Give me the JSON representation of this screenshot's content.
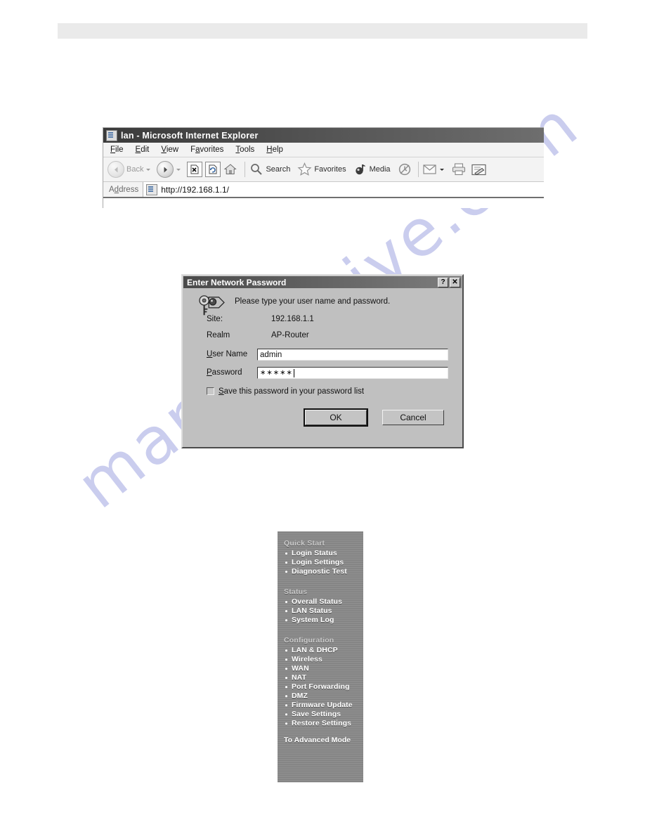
{
  "page": {
    "band_present": true,
    "watermark_text": "manualshive.com"
  },
  "browser": {
    "title": "lan - Microsoft Internet Explorer",
    "title_icon": "ie-page-icon",
    "menus": [
      {
        "label": "File",
        "accel": "F"
      },
      {
        "label": "Edit",
        "accel": "E"
      },
      {
        "label": "View",
        "accel": "V"
      },
      {
        "label": "Favorites",
        "accel": "a"
      },
      {
        "label": "Tools",
        "accel": "T"
      },
      {
        "label": "Help",
        "accel": "H"
      }
    ],
    "toolbar": {
      "back_label": "Back",
      "forward_label": "",
      "search_label": "Search",
      "favorites_label": "Favorites",
      "media_label": "Media",
      "icons": [
        "back-arrow-icon",
        "forward-arrow-icon",
        "stop-icon",
        "refresh-icon",
        "home-icon",
        "search-icon",
        "favorites-star-icon",
        "media-icon",
        "history-icon",
        "mail-icon",
        "print-icon",
        "edit-icon"
      ]
    },
    "address": {
      "label": "Address",
      "accel": "d",
      "value": "http://192.168.1.1/",
      "placeholder": "http://"
    }
  },
  "dialog": {
    "title": "Enter Network Password",
    "help_button": "?",
    "close_button": "✕",
    "icon": "key-and-lock-icon",
    "prompt": "Please type your user name and password.",
    "fields": {
      "site_label": "Site:",
      "site_value": "192.168.1.1",
      "realm_label": "Realm",
      "realm_value": "AP-Router",
      "username_label": "User Name",
      "username_accel": "U",
      "username_value": "admin",
      "username_placeholder": "",
      "password_label": "Password",
      "password_accel": "P",
      "password_value": "∗∗∗∗∗",
      "password_placeholder": ""
    },
    "checkbox": {
      "label": "Save this password in your password list",
      "accel": "S",
      "checked": false
    },
    "buttons": {
      "ok": "OK",
      "cancel": "Cancel"
    }
  },
  "navmenu": {
    "sections": [
      {
        "title": "Quick Start",
        "items": [
          "Login Status",
          "Login Settings",
          "Diagnostic Test"
        ]
      },
      {
        "title": "Status",
        "items": [
          "Overall Status",
          "LAN Status",
          "System Log"
        ]
      },
      {
        "title": "Configuration",
        "items": [
          "LAN & DHCP",
          "Wireless",
          "WAN",
          "NAT",
          "Port Forwarding",
          "DMZ",
          "Firmware Update",
          "Save Settings",
          "Restore Settings"
        ]
      }
    ],
    "footer": "To Advanced Mode"
  },
  "colors": {
    "page_band": "#eaeaea",
    "dialog_face": "#c0c0c0",
    "titlebar": "#4a4a4a",
    "nav_background": "#8b8b8b",
    "nav_text": "#ffffff",
    "nav_section_text": "#c9c9c9",
    "watermark": "#c8cbee"
  }
}
